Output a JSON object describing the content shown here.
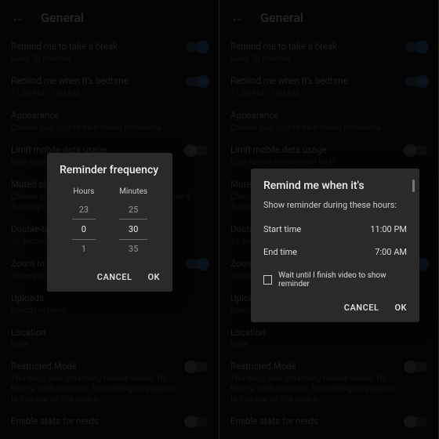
{
  "header": {
    "title": "General"
  },
  "settings": [
    {
      "title": "Remind me to take a break",
      "sub": "Every 30 minutes",
      "toggle": "on"
    },
    {
      "title": "Remind me when it's bedtime",
      "sub": "11:00 PM - 7:00 AM",
      "toggle": "on"
    },
    {
      "title": "Appearance",
      "sub": "Choose your light or dark theme preference",
      "toggle": null
    },
    {
      "title": "Limit mobile data usage",
      "sub": "Only stream HD video on Wi-Fi",
      "toggle": "off"
    },
    {
      "title": "Muted playback in feeds",
      "sub": "Choose whether videos play as you browse Home & Subscriptions",
      "toggle": null
    },
    {
      "title": "Double-tap to seek",
      "sub": "10 seconds",
      "toggle": null
    },
    {
      "title": "Zoom to fill screen",
      "sub": "Always zoom",
      "toggle": "on"
    },
    {
      "title": "Uploads",
      "sub": "Specify network",
      "toggle": null
    },
    {
      "title": "Location",
      "sub": "India",
      "toggle": null
    },
    {
      "title": "Restricted Mode",
      "sub": "This helps hide potentially mature videos. No filter is 100% accurate. This setting only applies to this app on this device.",
      "toggle": "off"
    },
    {
      "title": "Enable stats for nerds",
      "sub": "",
      "toggle": "off"
    }
  ],
  "dialog_freq": {
    "title": "Reminder frequency",
    "hours_label": "Hours",
    "minutes_label": "Minutes",
    "hours": [
      "23",
      "0",
      "1"
    ],
    "minutes": [
      "25",
      "30",
      "35"
    ],
    "cancel": "CANCEL",
    "ok": "OK"
  },
  "dialog_bedtime": {
    "title": "Remind me when it's",
    "subtitle": "Show reminder during these hours:",
    "start_label": "Start time",
    "start_value": "11:00 PM",
    "end_label": "End time",
    "end_value": "7:00 AM",
    "checkbox_label": "Wait until I finish video to show reminder",
    "cancel": "CANCEL",
    "ok": "OK"
  }
}
